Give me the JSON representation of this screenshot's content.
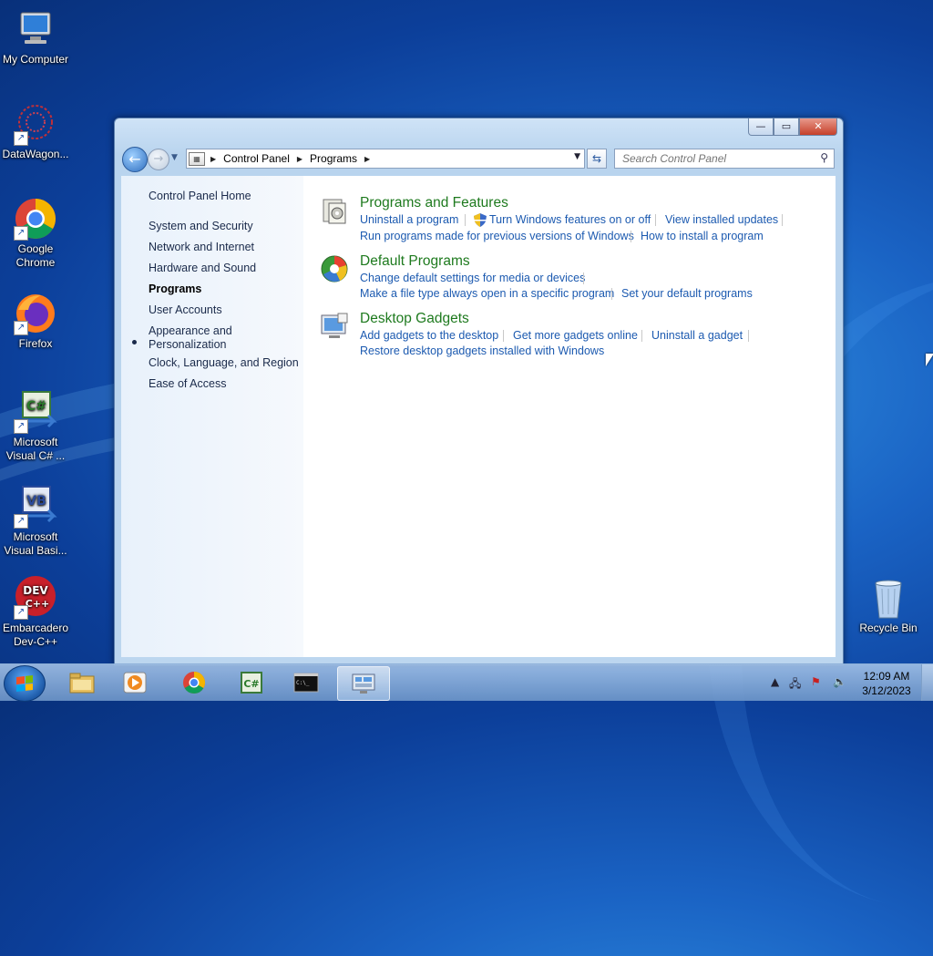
{
  "desktop": {
    "icons": [
      {
        "label": "My Computer",
        "icon": "my-computer-icon"
      },
      {
        "label": "DataWagon...",
        "icon": "datawagon-icon"
      },
      {
        "label": "Google Chrome",
        "icon": "chrome-icon"
      },
      {
        "label": "Firefox",
        "icon": "firefox-icon"
      },
      {
        "label": "Microsoft Visual C# ...",
        "icon": "visual-csharp-icon"
      },
      {
        "label": "Microsoft Visual Basi...",
        "icon": "visual-basic-icon"
      },
      {
        "label": "Embarcadero Dev-C++",
        "icon": "devcpp-icon"
      },
      {
        "label": "Recycle Bin",
        "icon": "recycle-bin-icon"
      }
    ]
  },
  "window": {
    "controls": {
      "minimize": "—",
      "maximize": "▭",
      "close": "✕"
    },
    "address": {
      "crumbs": [
        "Control Panel",
        "Programs"
      ]
    },
    "search": {
      "placeholder": "Search Control Panel"
    }
  },
  "sidebar": {
    "home": "Control Panel Home",
    "items": [
      {
        "label": "System and Security"
      },
      {
        "label": "Network and Internet"
      },
      {
        "label": "Hardware and Sound"
      },
      {
        "label": "Programs",
        "selected": true
      },
      {
        "label": "User Accounts"
      },
      {
        "label": "Appearance and Personalization"
      },
      {
        "label": "Clock, Language, and Region"
      },
      {
        "label": "Ease of Access"
      }
    ]
  },
  "categories": [
    {
      "title": "Programs and Features",
      "icon": "programs-features-icon",
      "links": [
        "Uninstall a program",
        "Turn Windows features on or off",
        "View installed updates",
        "Run programs made for previous versions of Windows",
        "How to install a program"
      ]
    },
    {
      "title": "Default Programs",
      "icon": "default-programs-icon",
      "links": [
        "Change default settings for media or devices",
        "Make a file type always open in a specific program",
        "Set your default programs"
      ]
    },
    {
      "title": "Desktop Gadgets",
      "icon": "desktop-gadgets-icon",
      "links": [
        "Add gadgets to the desktop",
        "Get more gadgets online",
        "Uninstall a gadget",
        "Restore desktop gadgets installed with Windows"
      ]
    }
  ],
  "taskbar": {
    "apps": [
      "file-explorer",
      "media-player",
      "chrome",
      "visual-csharp",
      "command-prompt",
      "control-panel"
    ],
    "active": "control-panel",
    "clock": {
      "time": "12:09 AM",
      "date": "3/12/2023"
    }
  }
}
